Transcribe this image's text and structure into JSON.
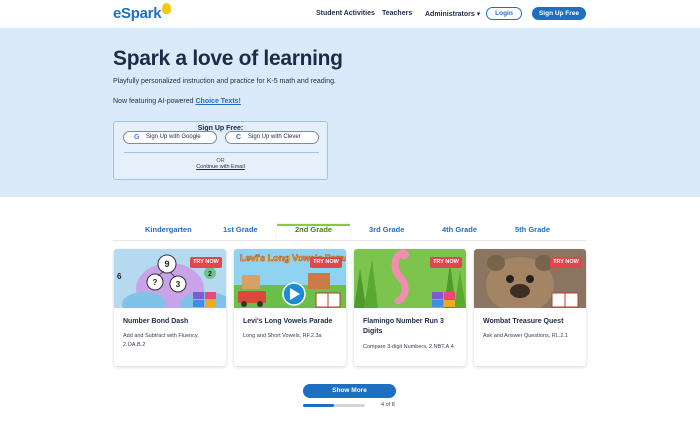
{
  "header": {
    "logo_e": "e",
    "logo_text": "Spark",
    "nav": [
      "Student Activities",
      "Teachers",
      "Administrators ▾"
    ],
    "login_label": "Login",
    "signup_label": "Sign Up Free"
  },
  "hero": {
    "title": "Spark a love of learning",
    "subtitle": "Playfully personalized instruction and practice for K-5 math and reading.",
    "featuring_prefix": "Now featuring AI-powered ",
    "featuring_link": "Choice Texts!",
    "signup_box": {
      "title": "Sign Up Free:",
      "google_label": "Sign Up with Google",
      "google_glyph": "G",
      "clever_label": "Sign Up with Clever",
      "clever_glyph": "C",
      "or_label": "OR",
      "email_label": "Continue with Email"
    }
  },
  "tabs": [
    "Kindergarten",
    "1st Grade",
    "2nd Grade",
    "3rd Grade",
    "4th Grade",
    "5th Grade"
  ],
  "active_tab_index": 2,
  "cards": [
    {
      "title": "Number Bond Dash",
      "desc": "Add and Subtract with Fluency, 2.OA.B.2",
      "badge": "TRY NOW",
      "bubble_top": "9",
      "bubble_left": "?",
      "bubble_right": "3",
      "num_left": "6",
      "num_right": "2"
    },
    {
      "title": "Levi's Long Vowels Parade",
      "desc": "Long and Short Vowels, RF.2.3a",
      "badge": "TRY NOW",
      "banner": "Levi's Long Vowels Parade"
    },
    {
      "title": "Flamingo Number Run 3 Digits",
      "desc": "Compare 3-digit Numbers, 2.NBT.A.4",
      "badge": "TRY NOW"
    },
    {
      "title": "Wombat Treasure Quest",
      "desc": "Ask and Answer Questions, RL.2.1",
      "badge": "TRY NOW"
    }
  ],
  "pagination": {
    "show_more_label": "Show More",
    "current": 4,
    "total": 8,
    "label": "4 of 8"
  },
  "colors": {
    "brand_blue": "#1e6fc1",
    "hero_bg": "#dbeafa",
    "active_tab_green": "#8dc63f",
    "try_now_red": "#e0474c"
  }
}
